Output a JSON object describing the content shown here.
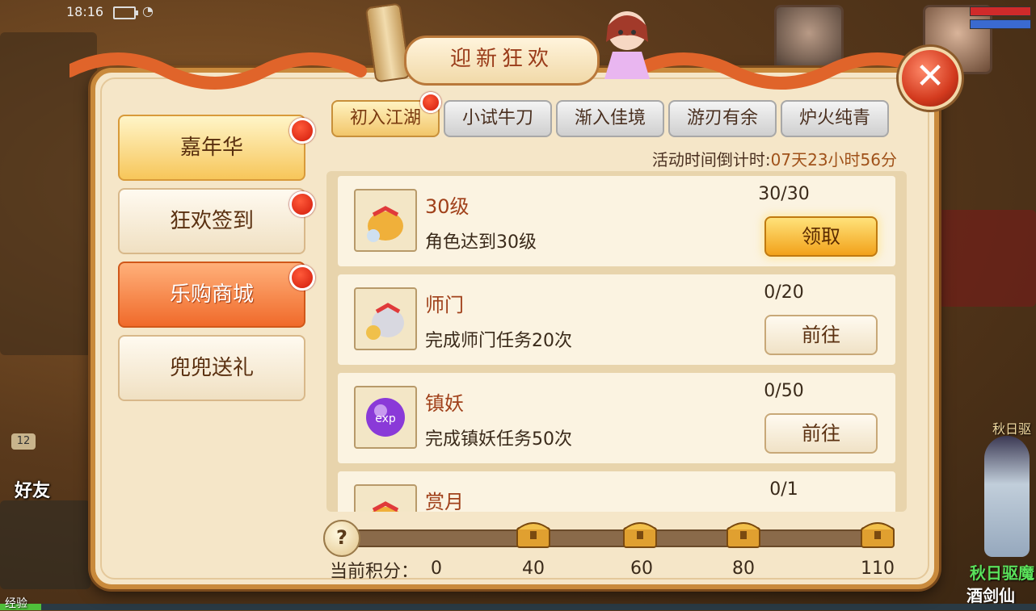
{
  "status_bar": {
    "time": "18:16"
  },
  "game_hud": {
    "friend_label": "好友",
    "friend_level": "12",
    "exp_label": "经验",
    "npc_small": "秋日驱",
    "npc_title": "秋日驱魔",
    "npc_name": "酒剑仙"
  },
  "dialog": {
    "title": "迎新狂欢",
    "close_icon": "close-x-icon"
  },
  "side_menu": [
    {
      "label": "嘉年华",
      "style": "gold",
      "has_dot": true
    },
    {
      "label": "狂欢签到",
      "style": "normal",
      "has_dot": true
    },
    {
      "label": "乐购商城",
      "style": "active",
      "has_dot": true
    },
    {
      "label": "兜兜送礼",
      "style": "normal",
      "has_dot": false
    }
  ],
  "tabs": [
    {
      "label": "初入江湖",
      "active": true,
      "has_dot": true
    },
    {
      "label": "小试牛刀",
      "active": false,
      "has_dot": false
    },
    {
      "label": "渐入佳境",
      "active": false,
      "has_dot": false
    },
    {
      "label": "游刃有余",
      "active": false,
      "has_dot": false
    },
    {
      "label": "炉火纯青",
      "active": false,
      "has_dot": false
    }
  ],
  "countdown": {
    "label": "活动时间倒计时:",
    "value": "07天23小时56分"
  },
  "tasks": [
    {
      "name": "30级",
      "desc": "角色达到30级",
      "progress": "30/30",
      "button": "领取",
      "claimable": true,
      "icon": "gift-bag-icon"
    },
    {
      "name": "师门",
      "desc": "完成师门任务20次",
      "progress": "0/20",
      "button": "前往",
      "claimable": false,
      "icon": "gift-bag-icon"
    },
    {
      "name": "镇妖",
      "desc": "完成镇妖任务50次",
      "progress": "0/50",
      "button": "前往",
      "claimable": false,
      "icon": "exp-orb-icon"
    },
    {
      "name": "赏月",
      "desc": "",
      "progress": "0/1",
      "button": "",
      "claimable": false,
      "icon": "gift-bag-icon"
    }
  ],
  "score": {
    "label": "当前积分：",
    "current": "0",
    "milestones": [
      "40",
      "60",
      "80",
      "110"
    ]
  },
  "colors": {
    "accent": "#f06a2a",
    "dot": "#d11a0a",
    "panel": "#f5e6c8"
  }
}
